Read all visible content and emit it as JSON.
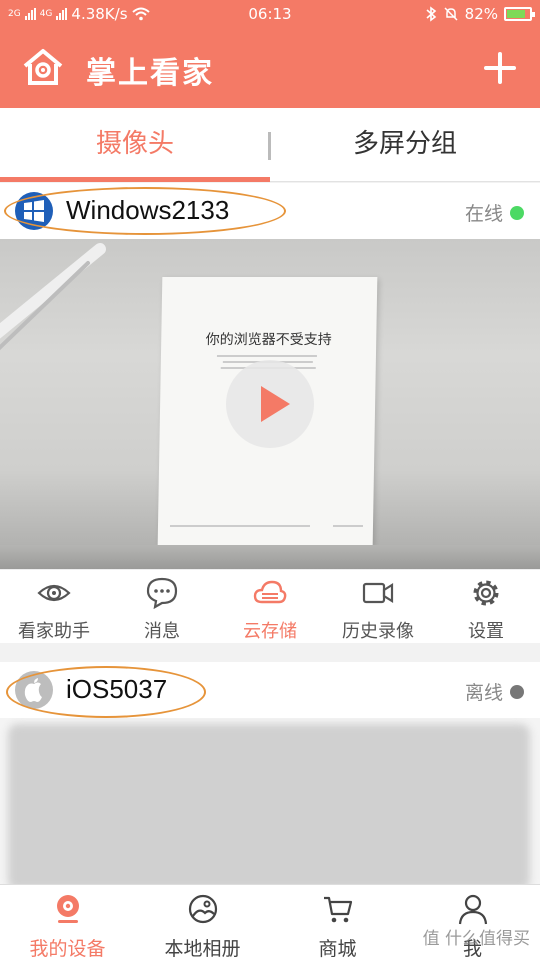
{
  "status_bar": {
    "signal_1": "2G",
    "signal_2": "4G",
    "speed": "4.38K/s",
    "time": "06:13",
    "battery": "82%",
    "battery_level": 0.82
  },
  "header": {
    "title": "掌上看家",
    "accent_color": "#f47a66"
  },
  "tabs": [
    {
      "label": "摄像头",
      "active": true
    },
    {
      "label": "多屏分组",
      "active": false
    }
  ],
  "devices": [
    {
      "name": "Windows2133",
      "status": "在线",
      "status_color": "#4cd964",
      "preview_doc_title": "你的浏览器不受支持",
      "actions": [
        {
          "label": "看家助手",
          "icon": "eye-icon"
        },
        {
          "label": "消息",
          "icon": "message-icon"
        },
        {
          "label": "云存储",
          "icon": "cloud-icon",
          "highlight": true
        },
        {
          "label": "历史录像",
          "icon": "video-camera-icon"
        },
        {
          "label": "设置",
          "icon": "gear-icon"
        }
      ]
    },
    {
      "name": "iOS5037",
      "status": "离线",
      "status_color": "#777777"
    }
  ],
  "bottom_nav": [
    {
      "label": "我的设备",
      "icon": "camera-device-icon",
      "active": true
    },
    {
      "label": "本地相册",
      "icon": "album-icon"
    },
    {
      "label": "商城",
      "icon": "cart-icon"
    },
    {
      "label": "我",
      "icon": "person-icon"
    }
  ],
  "watermark": "值 什么值得买"
}
